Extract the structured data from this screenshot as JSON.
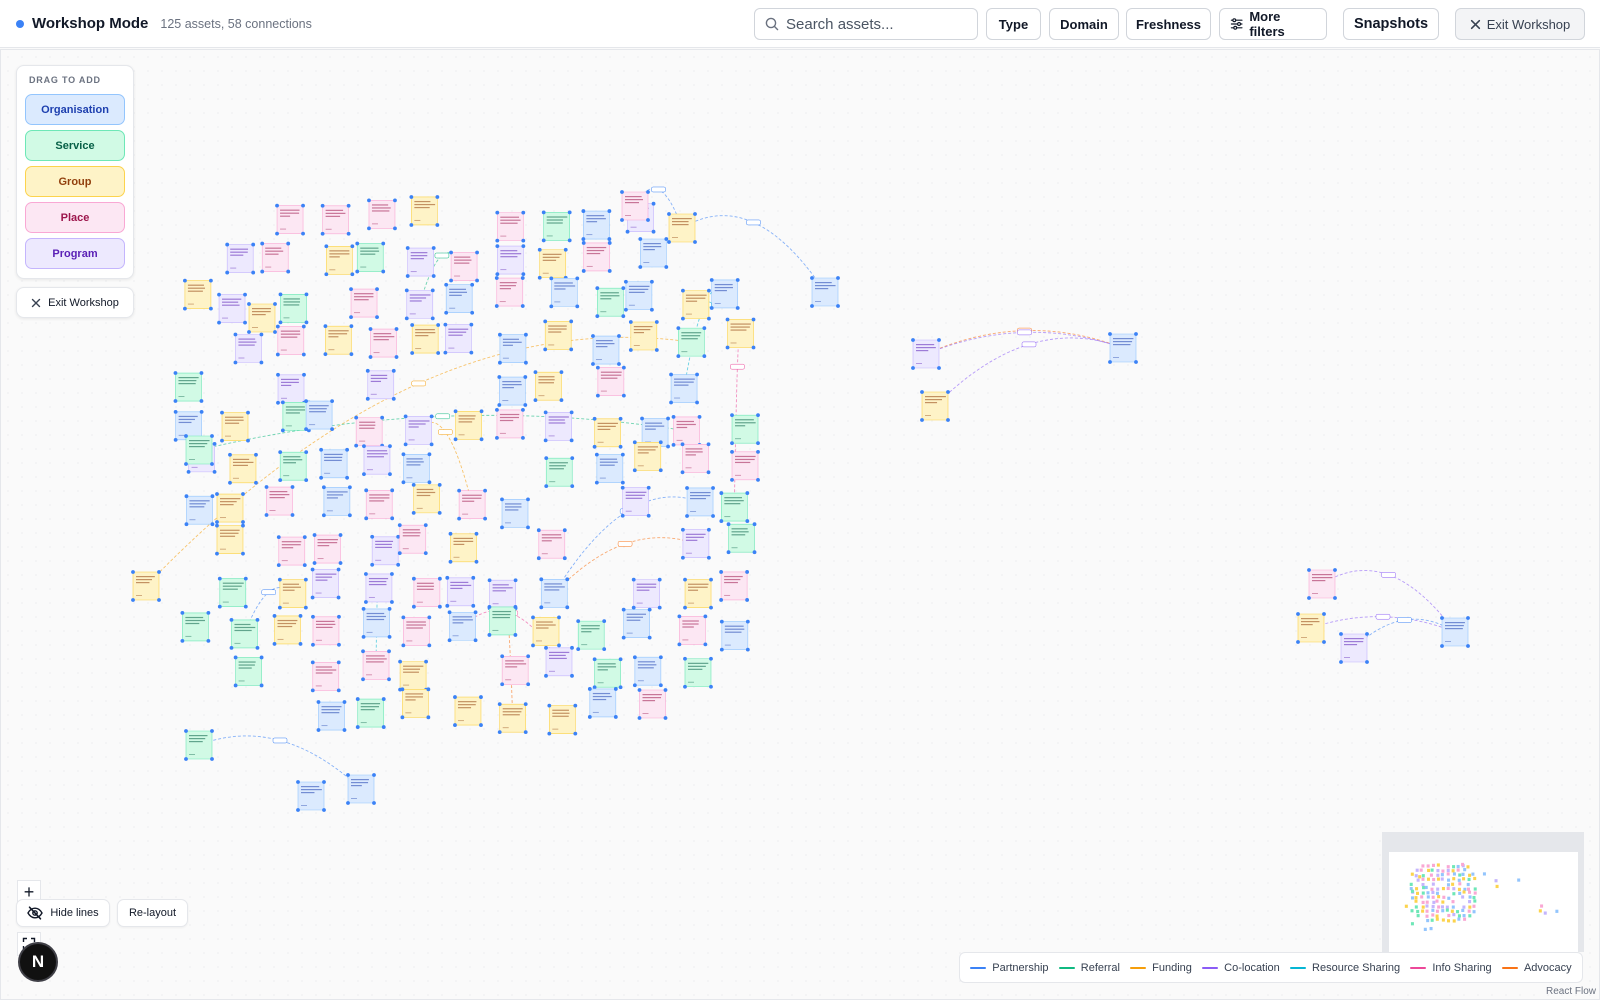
{
  "header": {
    "status_dot_color": "#3b82f6",
    "title": "Workshop Mode",
    "subtitle": "125 assets, 58 connections",
    "search_placeholder": "Search assets...",
    "filters": [
      "Type",
      "Domain",
      "Freshness"
    ],
    "more_filters_label": "More filters",
    "snapshots_label": "Snapshots",
    "exit_label": "Exit Workshop"
  },
  "palette": {
    "heading": "DRAG TO ADD",
    "items": [
      {
        "label": "Organisation",
        "bg": "#dbeafe",
        "border": "#93c5fd",
        "text": "#1e40af"
      },
      {
        "label": "Service",
        "bg": "#d1fae5",
        "border": "#6ee7b7",
        "text": "#065f46"
      },
      {
        "label": "Group",
        "bg": "#fef3c7",
        "border": "#fcd34d",
        "text": "#92400e"
      },
      {
        "label": "Place",
        "bg": "#fce7f3",
        "border": "#f9a8d4",
        "text": "#9d174d"
      },
      {
        "label": "Program",
        "bg": "#ede9fe",
        "border": "#c4b5fd",
        "text": "#5b21b6"
      }
    ],
    "exit_label": "Exit Workshop"
  },
  "controls": {
    "hide_lines_label": "Hide lines",
    "relayout_label": "Re-layout",
    "avatar_letter": "N"
  },
  "legend": [
    {
      "label": "Partnership",
      "color": "#3b82f6"
    },
    {
      "label": "Referral",
      "color": "#10b981"
    },
    {
      "label": "Funding",
      "color": "#f59e0b"
    },
    {
      "label": "Co-location",
      "color": "#8b5cf6"
    },
    {
      "label": "Resource Sharing",
      "color": "#06b6d4"
    },
    {
      "label": "Info Sharing",
      "color": "#ec4899"
    },
    {
      "label": "Advocacy",
      "color": "#f97316"
    }
  ],
  "attribution": "React Flow"
}
